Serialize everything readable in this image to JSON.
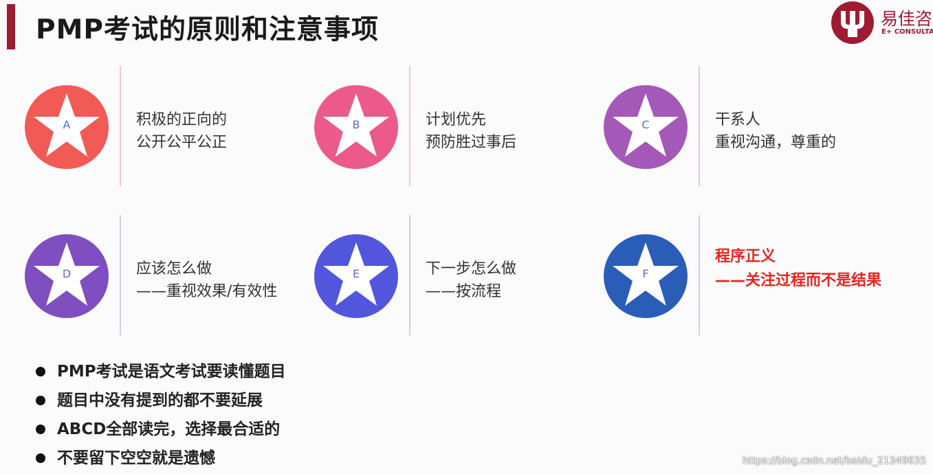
{
  "header": {
    "title": "PMP考试的原则和注意事项",
    "logo_cn": "易佳咨",
    "logo_en": "E+ CONSULTA"
  },
  "cards": [
    {
      "letter": "A",
      "line1": "积极的正向的",
      "line2": "公开公平公正",
      "color": "#f25a56",
      "divider": "#f4c7d0"
    },
    {
      "letter": "B",
      "line1": "计划优先",
      "line2": "预防胜过事后",
      "color": "#ec5a8c",
      "divider": "#f4c7d0"
    },
    {
      "letter": "C",
      "line1": "干系人",
      "line2": "重视沟通，尊重的",
      "color": "#a458b8",
      "divider": "#e4c9e6"
    },
    {
      "letter": "D",
      "line1": "应该怎么做",
      "line2": "——重视效果/有效性",
      "color": "#7f4ec0",
      "divider": "#d6cbe8"
    },
    {
      "letter": "E",
      "line1": "下一步怎么做",
      "line2": "——按流程",
      "color": "#5256dc",
      "divider": "#c8cbef"
    },
    {
      "letter": "F",
      "line1": "程序正义",
      "line2": "——关注过程而不是结果",
      "color": "#2a5db8",
      "divider": "#c7d2ec"
    }
  ],
  "bullets": [
    "PMP考试是语文考试要读懂题目",
    "题目中没有提到的都不要延展",
    "ABCD全部读完，选择最合适的",
    "不要留下空空就是遗憾"
  ],
  "watermark": "https://blog.csdn.net/baidu_21349635"
}
